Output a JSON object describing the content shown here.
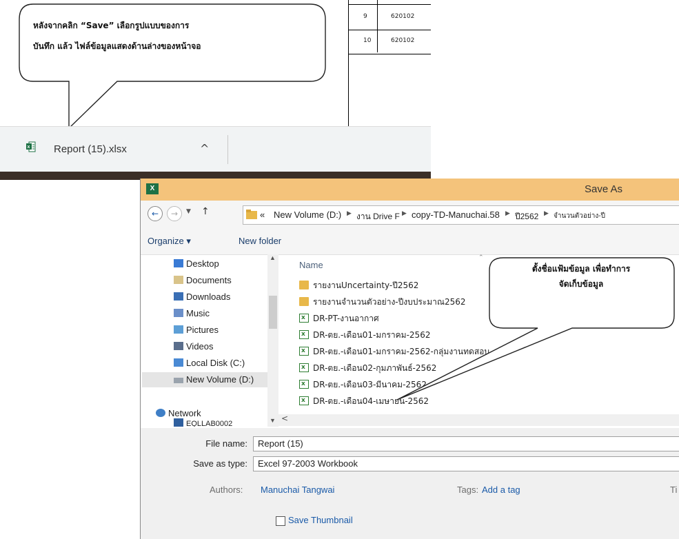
{
  "table": {
    "rows": [
      {
        "num": "9",
        "code": "620102"
      },
      {
        "num": "10",
        "code": "620102"
      }
    ]
  },
  "download": {
    "file_name": "Report (15).xlsx",
    "chevron": "^"
  },
  "callout_top": {
    "line1": "หลังจากคลิก “Save”  เลือกรูปแบบของการ",
    "line2": "บันทึก แล้ว ไฟล์ข้อมูลแสดงด้านล่างของหน้าจอ"
  },
  "callout_right": {
    "line1": "ตั้งชื่อแฟ้มข้อมูล เพื่อทำการ",
    "line2": "จัดเก็บข้อมูล"
  },
  "dialog": {
    "title": "Save As",
    "app_badge": "X",
    "breadcrumbs": {
      "prefix": "«",
      "items": [
        "New Volume (D:)",
        "งาน Drive F",
        "copy-TD-Manuchai.58",
        "ปี2562",
        "จำนวนตัวอย่าง-ปี"
      ]
    },
    "organize_label": "Organize ▾",
    "newfolder_label": "New folder",
    "nav_items": [
      {
        "label": "Desktop",
        "icon": "desktop-icon"
      },
      {
        "label": "Documents",
        "icon": "documents-icon"
      },
      {
        "label": "Downloads",
        "icon": "downloads-icon"
      },
      {
        "label": "Music",
        "icon": "music-icon"
      },
      {
        "label": "Pictures",
        "icon": "pictures-icon"
      },
      {
        "label": "Videos",
        "icon": "videos-icon"
      },
      {
        "label": "Local Disk (C:)",
        "icon": "drive-icon"
      },
      {
        "label": "New Volume (D:)",
        "icon": "drive-icon"
      },
      {
        "label": "Network",
        "icon": "network-icon"
      },
      {
        "label": "EQLLAB0002",
        "icon": "computer-icon"
      }
    ],
    "column_name": "Name",
    "files": [
      {
        "name": "รายงานUncertainty-ปี2562",
        "type": "folder"
      },
      {
        "name": "รายงานจำนวนตัวอย่าง-ปีงบประมาณ2562",
        "type": "folder"
      },
      {
        "name": "DR-PT-งานอากาศ",
        "type": "excel"
      },
      {
        "name": "DR-ตย.-เดือน01-มกราคม-2562",
        "type": "excel"
      },
      {
        "name": "DR-ตย.-เดือน01-มกราคม-2562-กลุ่มงานทดสอบ",
        "type": "excel"
      },
      {
        "name": "DR-ตย.-เดือน02-กุมภาพันธ์-2562",
        "type": "excel"
      },
      {
        "name": "DR-ตย.-เดือน03-มีนาคม-2562",
        "type": "excel"
      },
      {
        "name": "DR-ตย.-เดือน04-เมษายน-2562",
        "type": "excel"
      }
    ],
    "file_name_label": "File name:",
    "file_name_value": "Report (15)",
    "save_type_label": "Save as type:",
    "save_type_value": "Excel 97-2003 Workbook",
    "authors_label": "Authors:",
    "authors_value": "Manuchai Tangwai",
    "tags_label": "Tags:",
    "tags_value": "Add a tag",
    "title_label": "Ti",
    "thumbnail_label": "Save Thumbnail"
  }
}
